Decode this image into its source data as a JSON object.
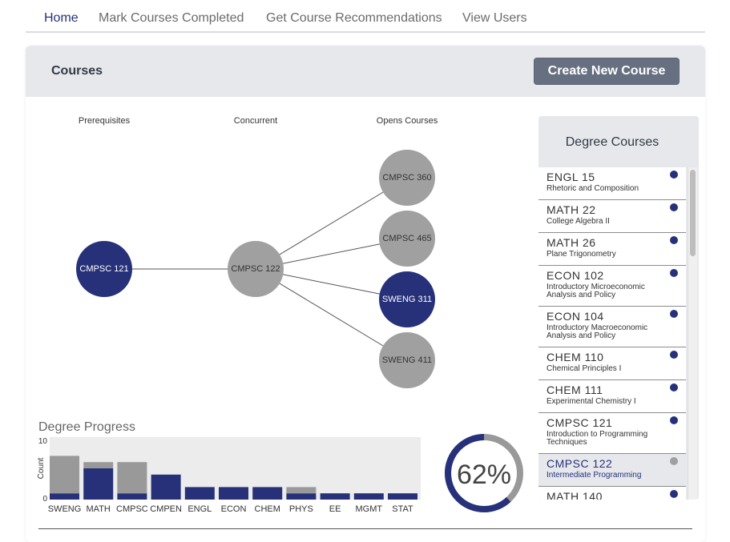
{
  "nav": {
    "items": [
      {
        "label": "Home",
        "active": true
      },
      {
        "label": "Mark Courses Completed",
        "active": false
      },
      {
        "label": "Get Course Recommendations",
        "active": false
      },
      {
        "label": "View Users",
        "active": false
      }
    ]
  },
  "card": {
    "title": "Courses",
    "create_button": "Create New Course"
  },
  "graph": {
    "columns": [
      "Prerequisites",
      "Concurrent",
      "Opens Courses"
    ],
    "nodes": {
      "prereq": {
        "label": "CMPSC 121",
        "completed": true
      },
      "current": {
        "label": "CMPSC 122",
        "completed": false
      },
      "opens": [
        {
          "label": "CMPSC 360",
          "completed": false
        },
        {
          "label": "CMPSC 465",
          "completed": false
        },
        {
          "label": "SWENG 311",
          "completed": true
        },
        {
          "label": "SWENG 411",
          "completed": false
        }
      ]
    }
  },
  "progress": {
    "title": "Degree Progress",
    "donut_label": "62%",
    "donut_value": 0.62
  },
  "colors": {
    "navy": "#26317a",
    "grey": "#a0a0a0",
    "plot_bg": "#ececec"
  },
  "chart_data": {
    "type": "bar",
    "ylabel": "Count",
    "ylim": [
      0,
      10
    ],
    "yticks": [
      "10",
      "0"
    ],
    "categories": [
      "SWENG",
      "MATH",
      "CMPSC",
      "CMPEN",
      "ENGL",
      "ECON",
      "CHEM",
      "PHYS",
      "EE",
      "MGMT",
      "STAT"
    ],
    "series": [
      {
        "name": "",
        "color": "#26317a",
        "values": [
          1,
          5,
          1,
          4,
          2,
          2,
          2,
          1,
          1,
          1,
          1
        ]
      },
      {
        "name": "",
        "color": "#999999",
        "values": [
          6,
          1,
          5,
          0,
          0,
          0,
          0,
          1,
          0,
          0,
          0
        ]
      }
    ]
  },
  "degree_courses": {
    "title": "Degree Courses",
    "items": [
      {
        "code": "ENGL 15",
        "name": "Rhetoric and Composition",
        "status": "navy"
      },
      {
        "code": "MATH 22",
        "name": "College Algebra II",
        "status": "navy"
      },
      {
        "code": "MATH 26",
        "name": "Plane Trigonometry",
        "status": "navy"
      },
      {
        "code": "ECON 102",
        "name": "Introductory Microeconomic Analysis and Policy",
        "status": "navy"
      },
      {
        "code": "ECON 104",
        "name": "Introductory Macroeconomic Analysis and Policy",
        "status": "navy"
      },
      {
        "code": "CHEM 110",
        "name": "Chemical Principles I",
        "status": "navy"
      },
      {
        "code": "CHEM 111",
        "name": "Experimental Chemistry I",
        "status": "navy"
      },
      {
        "code": "CMPSC 121",
        "name": "Introduction to Programming Techniques",
        "status": "navy"
      },
      {
        "code": "CMPSC 122",
        "name": "Intermediate Programming",
        "status": "grey",
        "selected": true
      },
      {
        "code": "MATH 140",
        "name": "",
        "status": "navy"
      }
    ]
  }
}
